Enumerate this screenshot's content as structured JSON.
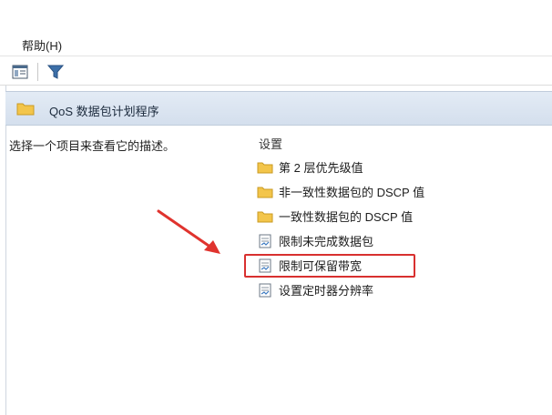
{
  "menubar": {
    "help_label": "帮助(H)"
  },
  "toolbar": {
    "buttons": [
      {
        "icon": "show-hide-tree-icon"
      },
      {
        "icon": "filter-icon"
      }
    ]
  },
  "node": {
    "title": "QoS 数据包计划程序",
    "icon": "folder-icon"
  },
  "description_hint": "选择一个项目来查看它的描述。",
  "settings": {
    "header": "设置",
    "items": [
      {
        "label": "第 2 层优先级值",
        "type": "folder"
      },
      {
        "label": "非一致性数据包的 DSCP 值",
        "type": "folder"
      },
      {
        "label": "一致性数据包的 DSCP 值",
        "type": "folder"
      },
      {
        "label": "限制未完成数据包",
        "type": "setting"
      },
      {
        "label": "限制可保留带宽",
        "type": "setting",
        "highlighted": true
      },
      {
        "label": "设置定时器分辨率",
        "type": "setting"
      }
    ]
  },
  "colors": {
    "highlight": "#d8302f",
    "folder": "#f3c54a",
    "arrow": "#e0332e"
  }
}
